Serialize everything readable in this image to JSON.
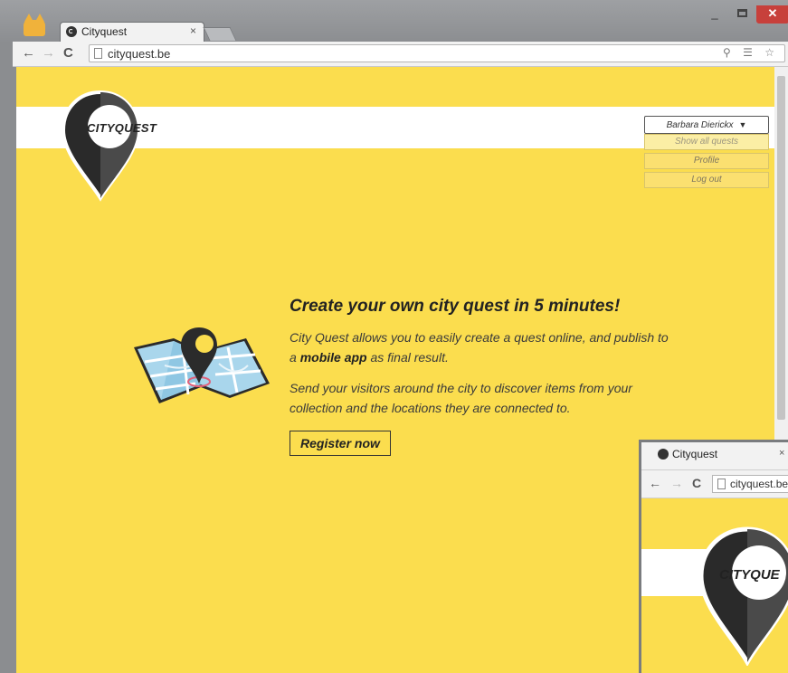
{
  "browser": {
    "tab_title": "Cityquest",
    "tab_close": "×",
    "url": "cityquest.be",
    "nav": {
      "back": "←",
      "forward": "→",
      "reload": "C"
    },
    "omnibox_icons": "⚲ ☰ ☆",
    "menu": "≡",
    "window_controls": {
      "minimize": "_",
      "close": "✕"
    }
  },
  "site": {
    "logo_text": "CITYQUEST",
    "user_menu": {
      "username": "Barbara Dierickx",
      "caret": "▼",
      "items": [
        "Show all quests",
        "Profile",
        "Log out"
      ]
    },
    "hero": {
      "title": "Create your own city quest in 5 minutes!",
      "p1_before": "City Quest allows you to easily create a quest online, and publish to a ",
      "p1_bold": "mobile app",
      "p1_after": " as final result.",
      "p2": "Send your visitors around the city to discover items from your collection and the locations they are connected to.",
      "register": "Register now"
    }
  },
  "second_window": {
    "tab_title": "Cityquest",
    "tab_close": "×",
    "url": "cityquest.be",
    "nav": {
      "back": "←",
      "forward": "→",
      "reload": "C"
    },
    "logo_text": "CITYQUE"
  },
  "colors": {
    "page_bg": "#fbdd4e",
    "accent_dark": "#222222",
    "close_red": "#c7403b"
  }
}
